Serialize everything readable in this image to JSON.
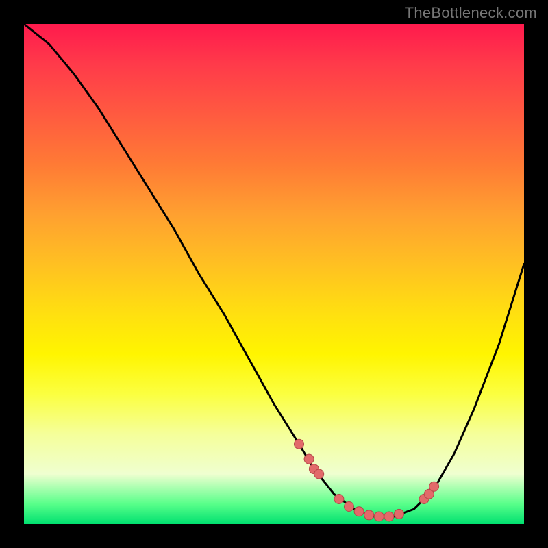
{
  "watermark": "TheBottleneck.com",
  "colors": {
    "curve": "#000000",
    "marker_fill": "#e26a6a",
    "marker_stroke": "#b44848"
  },
  "chart_data": {
    "type": "line",
    "title": "",
    "xlabel": "",
    "ylabel": "",
    "xlim": [
      0,
      100
    ],
    "ylim": [
      0,
      100
    ],
    "grid": false,
    "legend": false,
    "series": [
      {
        "name": "bottleneck-curve",
        "x": [
          0,
          5,
          10,
          15,
          20,
          25,
          30,
          35,
          40,
          45,
          50,
          55,
          58,
          62,
          66,
          70,
          74,
          78,
          82,
          86,
          90,
          95,
          100
        ],
        "y": [
          100,
          96,
          90,
          83,
          75,
          67,
          59,
          50,
          42,
          33,
          24,
          16,
          11,
          6,
          3,
          1.5,
          1.5,
          3,
          7,
          14,
          23,
          36,
          52
        ]
      }
    ],
    "markers": {
      "name": "highlight-points",
      "x": [
        55,
        57,
        58,
        59,
        63,
        65,
        67,
        69,
        71,
        73,
        75,
        80,
        81,
        82
      ],
      "y": [
        16,
        13,
        11,
        10,
        5,
        3.5,
        2.5,
        1.8,
        1.5,
        1.5,
        2,
        5,
        6,
        7.5
      ]
    }
  }
}
